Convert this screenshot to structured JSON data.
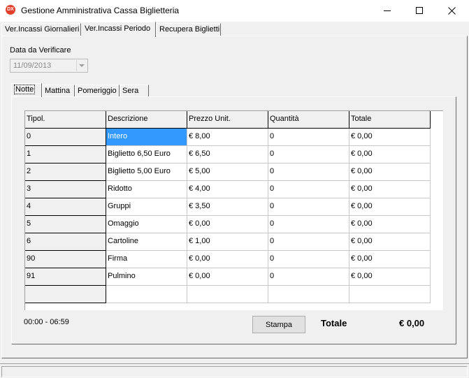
{
  "window": {
    "title": "Gestione Amministrativa Cassa Biglietteria",
    "icon_label": "DX"
  },
  "main_tabs": [
    {
      "label": "Ver.Incassi Giornalieri"
    },
    {
      "label": "Ver.Incassi Periodo"
    },
    {
      "label": "Recupera Biglietti"
    }
  ],
  "date_filter": {
    "label": "Data da Verificare",
    "value": "11/09/2013"
  },
  "sub_tabs": [
    {
      "label": "Notte"
    },
    {
      "label": "Mattina"
    },
    {
      "label": "Pomeriggio"
    },
    {
      "label": "Sera"
    }
  ],
  "grid": {
    "columns": [
      "Tipol.",
      "Descrizione",
      "Prezzo Unit.",
      "Quantità",
      "Totale"
    ],
    "rows": [
      {
        "tipol": "0",
        "descrizione": "Intero",
        "prezzo": "€ 8,00",
        "quantita": "0",
        "totale": "€ 0,00"
      },
      {
        "tipol": "1",
        "descrizione": "Biglietto 6,50 Euro",
        "prezzo": "€ 6,50",
        "quantita": "0",
        "totale": "€ 0,00"
      },
      {
        "tipol": "2",
        "descrizione": "Biglietto 5,00 Euro",
        "prezzo": "€ 5,00",
        "quantita": "0",
        "totale": "€ 0,00"
      },
      {
        "tipol": "3",
        "descrizione": "Ridotto",
        "prezzo": "€ 4,00",
        "quantita": "0",
        "totale": "€ 0,00"
      },
      {
        "tipol": "4",
        "descrizione": "Gruppi",
        "prezzo": "€ 3,50",
        "quantita": "0",
        "totale": "€ 0,00"
      },
      {
        "tipol": "5",
        "descrizione": "Omaggio",
        "prezzo": "€ 0,00",
        "quantita": "0",
        "totale": "€ 0,00"
      },
      {
        "tipol": "6",
        "descrizione": "Cartoline",
        "prezzo": "€ 1,00",
        "quantita": "0",
        "totale": "€ 0,00"
      },
      {
        "tipol": "90",
        "descrizione": "Firma",
        "prezzo": "€ 0,00",
        "quantita": "0",
        "totale": "€ 0,00"
      },
      {
        "tipol": "91",
        "descrizione": "Pulmino",
        "prezzo": "€ 0,00",
        "quantita": "0",
        "totale": "€ 0,00"
      },
      {
        "tipol": "",
        "descrizione": "",
        "prezzo": "",
        "quantita": "",
        "totale": ""
      }
    ]
  },
  "footer": {
    "time_range": "00:00 - 06:59",
    "print_label": "Stampa",
    "total_label": "Totale",
    "total_value": "€ 0,00"
  },
  "colors": {
    "selection": "#3399ff",
    "window_bg": "#f0f0f0"
  }
}
